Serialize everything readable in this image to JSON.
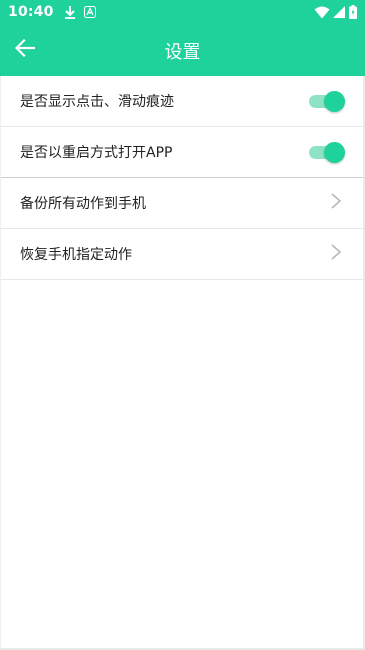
{
  "statusbar": {
    "time": "10:40",
    "icons": [
      "download-icon",
      "a-notification-icon",
      "wifi-icon",
      "signal-icon",
      "battery-icon"
    ]
  },
  "appbar": {
    "back_icon": "arrow-left-icon",
    "title": "设置"
  },
  "settings": {
    "switches": [
      {
        "label": "是否显示点击、滑动痕迹",
        "on": true
      },
      {
        "label": "是否以重启方式打开APP",
        "on": true
      }
    ],
    "links": [
      {
        "label": "备份所有动作到手机",
        "icon": "chevron-right-icon"
      },
      {
        "label": "恢复手机指定动作",
        "icon": "chevron-right-icon"
      }
    ]
  },
  "colors": {
    "accent": "#1fd19a",
    "accent_light": "#8fe3c5",
    "text": "#222222",
    "divider": "#e8e8e8",
    "chevron": "#b8b8b8"
  }
}
